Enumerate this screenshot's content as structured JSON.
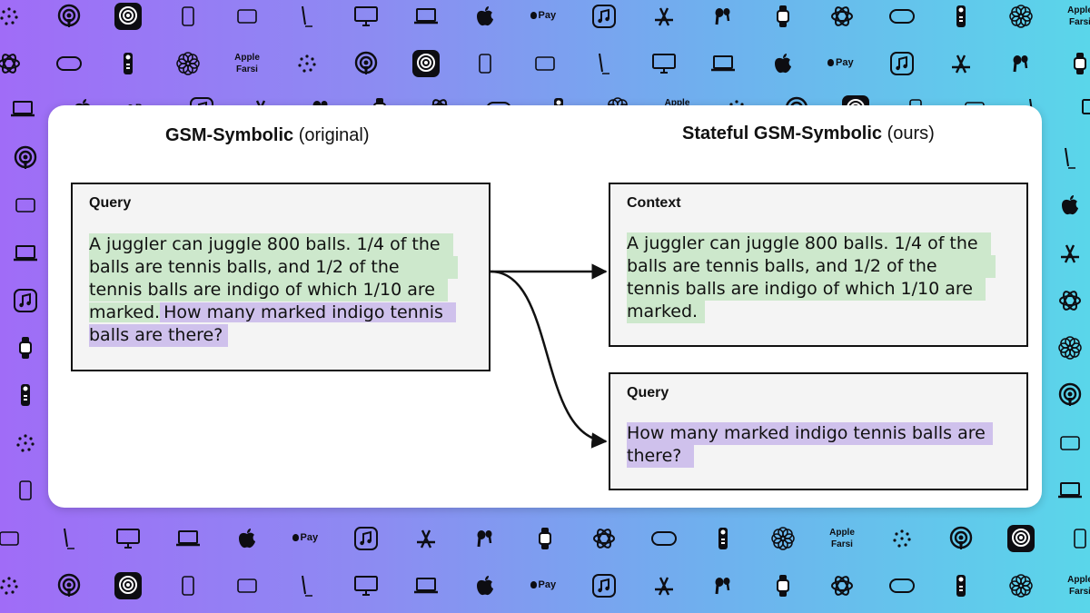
{
  "left_panel": {
    "title_bold": "GSM-Symbolic",
    "title_suffix": " (original)",
    "box_label": "Query",
    "context_lines": [
      "A juggler can juggle 800 balls. 1/4 of the",
      "balls are tennis balls, and 1/2 of the",
      "tennis balls are indigo of which 1/10 are",
      "marked."
    ],
    "question_parts": [
      "How many marked indigo tennis",
      "balls are there?"
    ]
  },
  "right_panel": {
    "title_bold": "Stateful GSM-Symbolic",
    "title_suffix": " (ours)",
    "context_label": "Context",
    "context_lines": [
      "A juggler can juggle 800 balls. 1/4 of the",
      "balls are tennis balls, and 1/2 of the",
      "tennis balls are indigo of which 1/10 are",
      "marked."
    ],
    "query_label": "Query",
    "query_lines": [
      "How many marked indigo tennis balls are",
      "there?"
    ]
  },
  "colors": {
    "context_highlight": "#cde8cc",
    "query_highlight": "#cfc1ec",
    "background_start": "#a06cf7",
    "background_end": "#5ad6ea"
  },
  "background_pattern": {
    "icon_names": [
      "ring-dots-icon",
      "podcasts-icon",
      "podcasts-app-icon",
      "iphone-icon",
      "ipad-icon",
      "pencil-icon",
      "imac-icon",
      "macbook-icon",
      "apple-logo-icon",
      "apple-pay-icon",
      "music-app-icon",
      "app-store-icon",
      "airpods-icon",
      "apple-watch-icon",
      "rings-icon",
      "vision-pro-icon",
      "tv-remote-icon",
      "flower-icon"
    ],
    "word_top": "Apple",
    "word_bottom": "Farsi",
    "pay_word": "Pay"
  }
}
